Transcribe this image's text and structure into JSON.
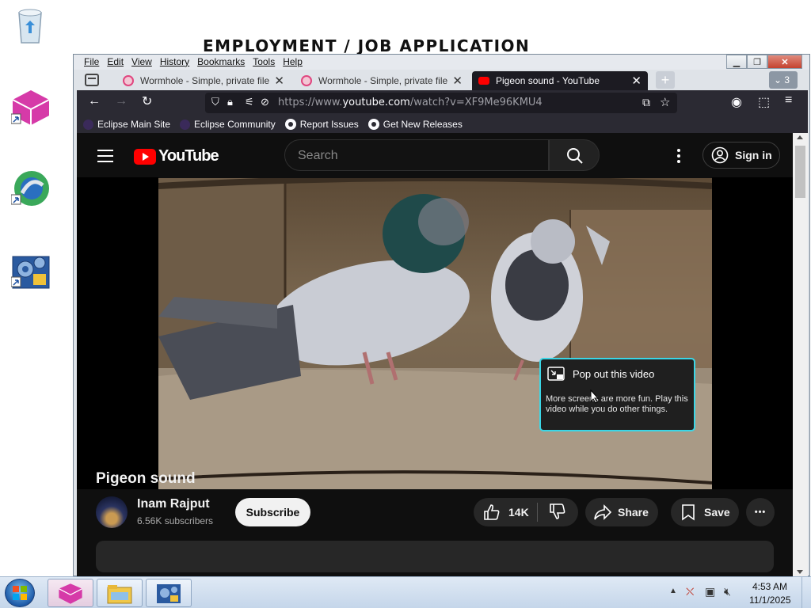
{
  "desktop": {
    "banner": "EMPLOYMENT / JOB APPLICATION"
  },
  "window": {
    "menu": [
      "File",
      "Edit",
      "View",
      "History",
      "Bookmarks",
      "Tools",
      "Help"
    ],
    "tabs": [
      {
        "title": "Wormhole - Simple, private file",
        "close": "✕"
      },
      {
        "title": "Wormhole - Simple, private file",
        "close": "✕"
      },
      {
        "title": "Pigeon sound - YouTube",
        "close": "✕"
      }
    ],
    "new_tab": "+",
    "tab_count": "3",
    "url_prefix": "https://www.",
    "url_host": "youtube.com",
    "url_path": "/watch?v=XF9Me96KMU4",
    "bookmarks": [
      {
        "label": "Eclipse Main Site"
      },
      {
        "label": "Eclipse Community"
      },
      {
        "label": "Report Issues"
      },
      {
        "label": "Get New Releases"
      }
    ]
  },
  "youtube": {
    "logo_text": "YouTube",
    "search_placeholder": "Search",
    "sign_in": "Sign in",
    "video_title": "Pigeon sound",
    "channel_name": "Inam Rajput",
    "subscribers": "6.56K subscribers",
    "subscribe": "Subscribe",
    "likes": "14K",
    "share": "Share",
    "save": "Save",
    "more": "•••",
    "popout": {
      "title": "Pop out this video",
      "body": "More screens are more fun. Play this video while you do other things."
    }
  },
  "taskbar": {
    "time": "4:53 AM",
    "date": "11/1/2025"
  }
}
